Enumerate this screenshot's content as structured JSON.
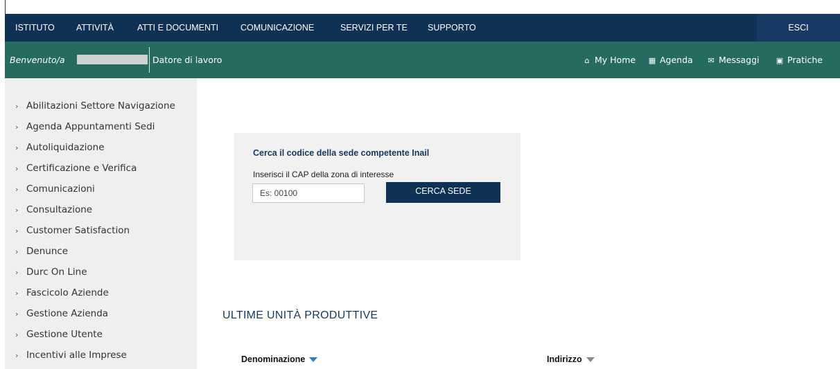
{
  "topnav": {
    "items": [
      "ISTITUTO",
      "ATTIVITÀ",
      "ATTI E DOCUMENTI",
      "COMUNICAZIONE",
      "SERVIZI PER TE",
      "SUPPORTO"
    ],
    "exit_label": "ESCI"
  },
  "subnav": {
    "welcome": "Benvenuto/a",
    "role": "Datore di lavoro",
    "links": [
      {
        "label": "My Home",
        "icon": "home-icon"
      },
      {
        "label": "Agenda",
        "icon": "calendar-icon"
      },
      {
        "label": "Messaggi",
        "icon": "envelope-icon"
      },
      {
        "label": "Pratiche",
        "icon": "document-icon"
      }
    ]
  },
  "sidebar": {
    "items": [
      "Abilitazioni Settore Navigazione",
      "Agenda Appuntamenti Sedi",
      "Autoliquidazione",
      "Certificazione e Verifica",
      "Comunicazioni",
      "Consultazione",
      "Customer Satisfaction",
      "Denunce",
      "Durc On Line",
      "Fascicolo Aziende",
      "Gestione Azienda",
      "Gestione Utente",
      "Incentivi alle Imprese"
    ]
  },
  "search": {
    "title": "Cerca il codice della sede competente Inail",
    "hint": "Inserisci il CAP della zona di interesse",
    "placeholder": "Es: 00100",
    "button": "CERCA SEDE"
  },
  "units": {
    "title": "ULTIME UNITÀ PRODUTTIVE",
    "columns": [
      "Denominazione",
      "Indirizzo"
    ]
  },
  "colors": {
    "nav_bg": "#0f3156",
    "subnav_bg": "#256b62",
    "sidebar_bg": "#efefef",
    "accent": "#15385f"
  }
}
